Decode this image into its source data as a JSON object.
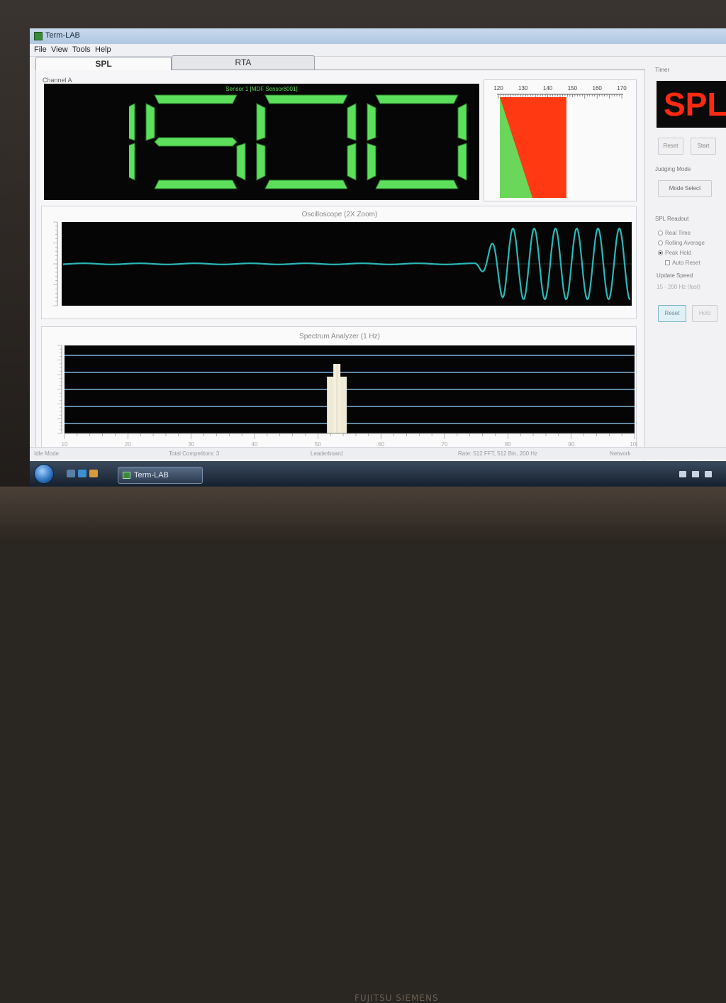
{
  "window": {
    "title": "Term-LAB"
  },
  "menu": [
    {
      "label": "File"
    },
    {
      "label": "View"
    },
    {
      "label": "Tools"
    },
    {
      "label": "Help"
    }
  ],
  "tabs": [
    {
      "label": "SPL",
      "active": true
    },
    {
      "label": "RTA",
      "active": false
    }
  ],
  "channel": {
    "label": "Channel A"
  },
  "readout": {
    "sensor_label": "Sensor 1 [MDF Sensor8001]",
    "value": "1500",
    "color": "#5ce05c"
  },
  "meter": {
    "scale": [
      "120",
      "130",
      "140",
      "150",
      "160",
      "170"
    ],
    "level_fraction": 0.54,
    "bar_color": "#ff3a12",
    "ref_color": "#6ad65a"
  },
  "oscilloscope": {
    "title": "Oscilloscope (2X Zoom)",
    "trace_color": "#29b8b8"
  },
  "spectrum": {
    "title": "Spectrum Analyzer (1 Hz)",
    "x_ticks": [
      "10",
      "20",
      "30",
      "40",
      "50",
      "60",
      "70",
      "80",
      "90",
      "100"
    ],
    "peak_frequency": 53,
    "gridline_color": "#7fb4d8"
  },
  "side": {
    "timer_label": "Timer",
    "timer_value": "SPL",
    "reset_label": "Reset",
    "start_label": "Start",
    "judging_label": "Judging Mode",
    "mode_select_label": "Mode Select",
    "readout_label": "SPL Readout",
    "options": [
      {
        "label": "Real Time",
        "selected": false
      },
      {
        "label": "Rolling Average",
        "selected": false
      },
      {
        "label": "Peak Hold",
        "selected": true
      }
    ],
    "auto_reset_label": "Auto Reset",
    "update_speed_label": "Update Speed",
    "update_speed_value": "15 - 200 Hz (fast)",
    "reset2_label": "Reset",
    "hold_label": "Hold"
  },
  "status": {
    "left": "Idle Mode",
    "mid": "Total Competitors: 3",
    "center": "Leaderboard",
    "rate": "Rate: 512 FFT, 512 Bin, 200 Hz",
    "right": "Network"
  },
  "taskbar": {
    "item_label": "Term-LAB"
  },
  "bezel": {
    "brand": "FUJITSU SIEMENS"
  }
}
